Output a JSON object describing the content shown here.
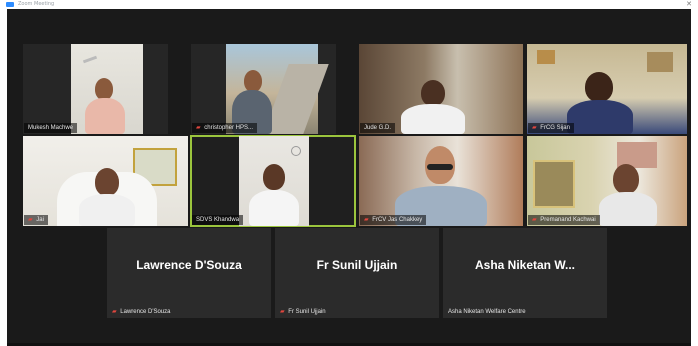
{
  "window": {
    "title": "Zoom Meeting"
  },
  "participants": [
    {
      "name": "Mukesh Machwe",
      "muted": false
    },
    {
      "name": "christopher HPS...",
      "muted": true
    },
    {
      "name": "Jude G.D.",
      "muted": false
    },
    {
      "name": "FrCG Sijan",
      "muted": true
    },
    {
      "name": "Jai",
      "muted": true
    },
    {
      "name": "SDVS Khandwa",
      "muted": false
    },
    {
      "name": "FrCV Jas Chakkey",
      "muted": true
    },
    {
      "name": "Premanand Kachwai",
      "muted": true
    },
    {
      "name": "Lawrence D'Souza",
      "display": "Lawrence D'Souza",
      "muted": true
    },
    {
      "name": "Fr Sunil Ujjain",
      "display": "Fr Sunil Ujjain",
      "muted": true
    },
    {
      "name": "Asha Niketan Welfare Centre",
      "display": "Asha Niketan W...",
      "muted": false
    }
  ],
  "active_speaker": "SDVS Khandwa",
  "colors": {
    "meeting_bg": "#1a1a1a",
    "tile_bg": "#2b2b2b",
    "active_border": "#9bc53d",
    "muted_icon": "#e0463e"
  },
  "icons": {
    "muted": "microphone-muted-icon",
    "app": "zoom-app-icon"
  }
}
